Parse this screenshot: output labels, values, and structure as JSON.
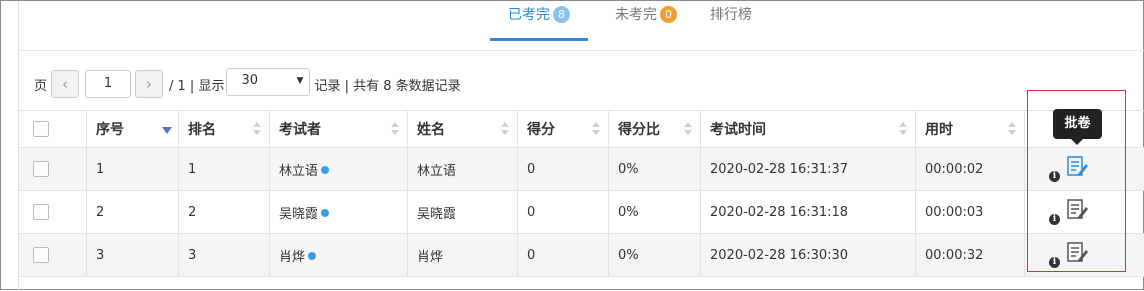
{
  "tabs": [
    {
      "label": "已考完",
      "badge": "8",
      "badge_color": "#89c4ef",
      "active": true
    },
    {
      "label": "未考完",
      "badge": "0",
      "badge_color": "#f0a030",
      "active": false
    },
    {
      "label": "排行榜",
      "badge": "",
      "active": false
    }
  ],
  "pager": {
    "page_label": "页",
    "prev_icon": "chevron-left-icon",
    "page_value": "1",
    "next_icon": "chevron-right-icon",
    "total_pages_text": "/ 1 | 显示",
    "page_size": "30",
    "summary": "记录 | 共有 8 条数据记录"
  },
  "table": {
    "columns": [
      "序号",
      "排名",
      "考试者",
      "姓名",
      "得分",
      "得分比",
      "考试时间",
      "用时"
    ],
    "rows": [
      {
        "seq": "1",
        "rank": "1",
        "examinee": "林立语",
        "name": "林立语",
        "score": "0",
        "ratio": "0%",
        "time": "2020-02-28 16:31:37",
        "duration": "00:00:02"
      },
      {
        "seq": "2",
        "rank": "2",
        "examinee": "吴晓霞",
        "name": "吴晓霞",
        "score": "0",
        "ratio": "0%",
        "time": "2020-02-28 16:31:18",
        "duration": "00:00:03"
      },
      {
        "seq": "3",
        "rank": "3",
        "examinee": "肖烨",
        "name": "肖烨",
        "score": "0",
        "ratio": "0%",
        "time": "2020-02-28 16:30:30",
        "duration": "00:00:32"
      }
    ]
  },
  "tooltip": {
    "text": "批卷"
  },
  "colors": {
    "accent": "#2e8bd4",
    "highlight": "#d9342b",
    "online_dot": "#3c9be8"
  }
}
